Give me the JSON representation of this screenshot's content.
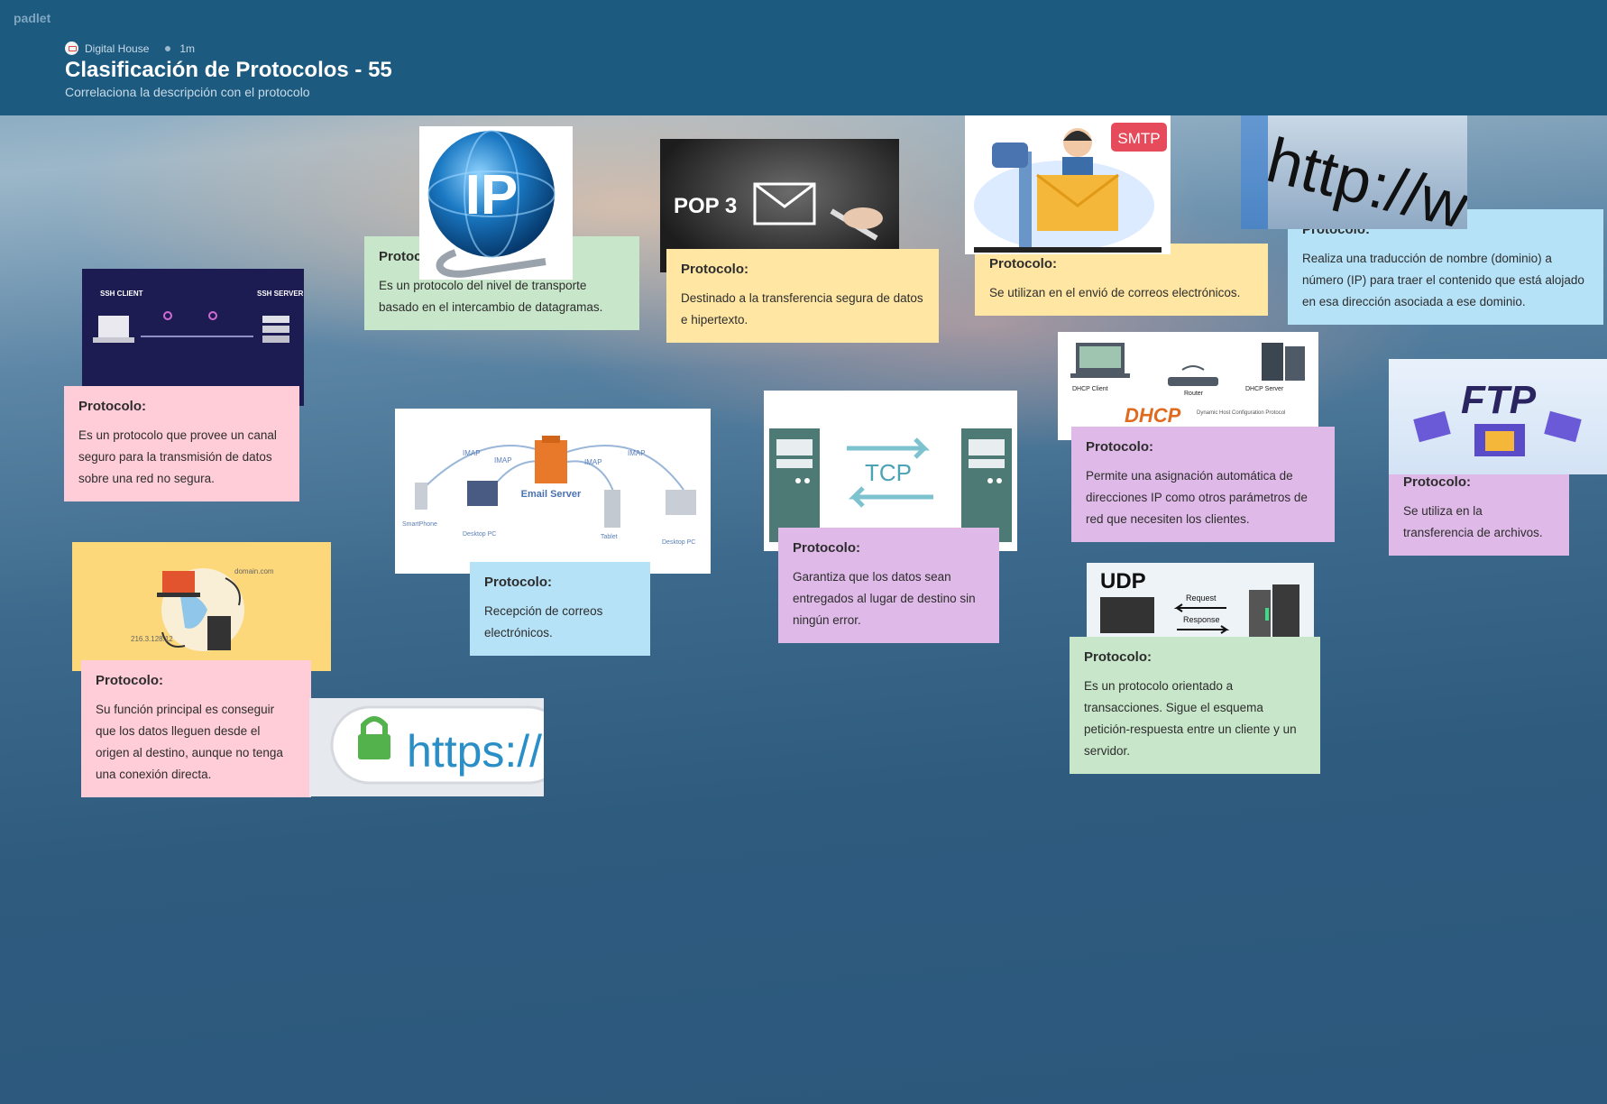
{
  "app": {
    "brand": "padlet"
  },
  "header": {
    "org": "Digital House",
    "time": "1m",
    "title": "Clasificación de Protocolos - 55",
    "subtitle": "Correlaciona la descripción con el protocolo"
  },
  "images": {
    "ssh": {
      "client": "SSH CLIENT",
      "server": "SSH SERVER"
    },
    "ip": {
      "text": "IP"
    },
    "pop3": {
      "text": "POP 3"
    },
    "smtp": {
      "text": "SMTP"
    },
    "http": {
      "text": "http://ww"
    },
    "dhcp": {
      "text": "DHCP",
      "client": "DHCP Client",
      "router": "Router",
      "server": "DHCP Server",
      "caption": "Dynamic Host Configuration Protocol"
    },
    "ftp": {
      "text": "FTP"
    },
    "email": {
      "server": "Email Server",
      "imap": "IMAP",
      "smartphone": "SmartPhone",
      "desktop": "Desktop PC",
      "tablet": "Tablet"
    },
    "tcp": {
      "text": "TCP"
    },
    "udp": {
      "text": "UDP",
      "request": "Request",
      "response": "Response"
    },
    "dns": {
      "domain": "domain.com",
      "ip": "216.3.128.12"
    },
    "https": {
      "text": "https://"
    }
  },
  "cards": {
    "c1": {
      "heading": "Protocolo:",
      "body": "Es un protocolo del nivel de transporte basado en el intercambio de datagramas."
    },
    "c2": {
      "heading": "Protocolo:",
      "body": "Destinado a la transferencia segura de datos e hipertexto."
    },
    "c3": {
      "heading": "Protocolo:",
      "body": "Se utilizan en el envió de correos electrónicos."
    },
    "c4": {
      "heading": "Protocolo:",
      "body": "Realiza una traducción de nombre (dominio) a número (IP) para traer el contenido que está alojado en esa dirección asociada a ese dominio."
    },
    "c5": {
      "heading": "Protocolo:",
      "body": "Es un protocolo que provee un canal seguro para la transmisión de datos sobre una red no segura."
    },
    "c6": {
      "heading": "Protocolo:",
      "body": "Recepción de correos electrónicos."
    },
    "c7": {
      "heading": "Protocolo:",
      "body": "Garantiza que los datos sean entregados al lugar de destino sin ningún error."
    },
    "c8": {
      "heading": "Protocolo:",
      "body": "Permite una asignación automática de direcciones IP como otros parámetros de red que necesiten los clientes."
    },
    "c9": {
      "heading": "Protocolo:",
      "body": "Se utiliza en la transferencia de archivos."
    },
    "c10": {
      "heading": "Protocolo:",
      "body": "Su función principal es conseguir que los datos lleguen desde el origen al destino, aunque no tenga una conexión directa."
    },
    "c11": {
      "heading": "Protocolo:",
      "body": "Es un protocolo orientado a transacciones. Sigue el esquema petición-respuesta entre un cliente y un servidor."
    }
  },
  "colors": {
    "header": "#1c5a80",
    "green": "#c8e6c9",
    "yellow": "#ffe7a3",
    "pink": "#ffcdd8",
    "blue": "#b5e2f7",
    "purple": "#dfb9e8"
  }
}
